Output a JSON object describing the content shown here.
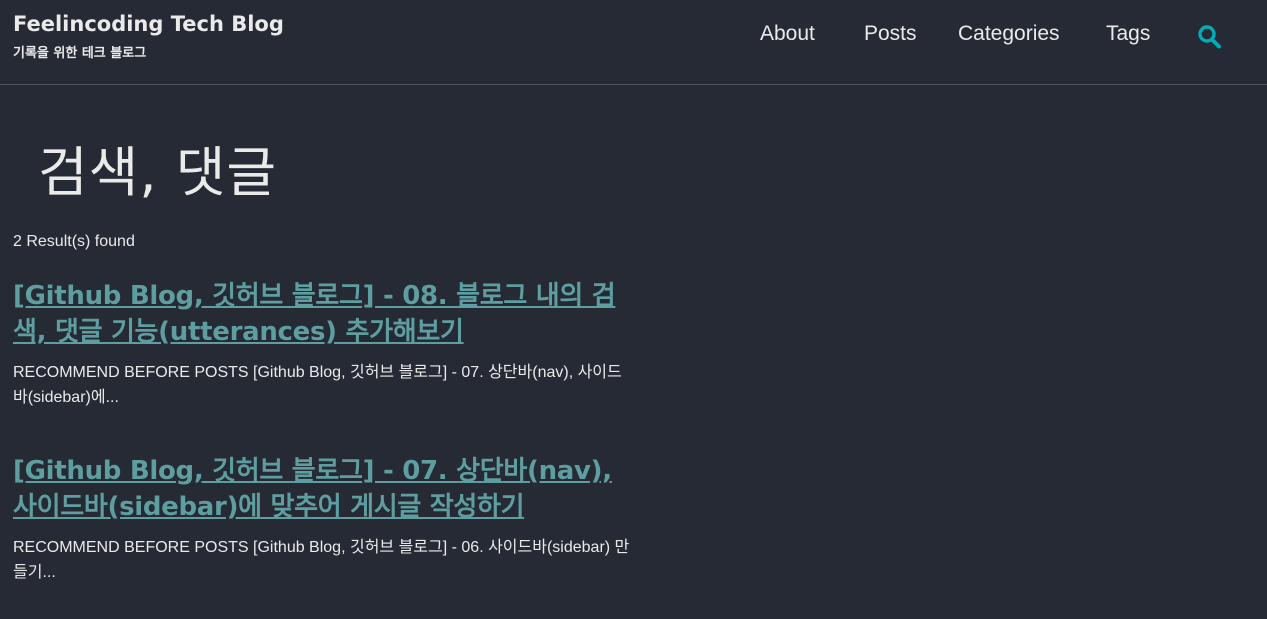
{
  "header": {
    "site_title": "Feelincoding Tech Blog",
    "site_subtitle": "기록을 위한 테크 블로그",
    "nav": [
      {
        "label": "About"
      },
      {
        "label": "Posts"
      },
      {
        "label": "Categories"
      },
      {
        "label": "Tags"
      }
    ],
    "search_icon": "search-icon"
  },
  "main": {
    "title": "검색, 댓글",
    "results_count": "2 Result(s) found",
    "results": [
      {
        "title": "[Github Blog, 깃허브 블로그] - 08. 블로그 내의 검색, 댓글 기능(utterances) 추가해보기",
        "excerpt": "RECOMMEND BEFORE POSTS [Github Blog, 깃허브 블로그] - 07. 상단바(nav), 사이드바(sidebar)에..."
      },
      {
        "title": "[Github Blog, 깃허브 블로그] - 07. 상단바(nav), 사이드바(sidebar)에 맞추어 게시글 작성하기",
        "excerpt": "RECOMMEND BEFORE POSTS [Github Blog, 깃허브 블로그] - 06. 사이드바(sidebar) 만들기..."
      }
    ]
  },
  "colors": {
    "background": "#252a34",
    "text": "#eaeaea",
    "link": "#5f9ea0",
    "accent": "#00adb5",
    "divider": "#50555e"
  }
}
